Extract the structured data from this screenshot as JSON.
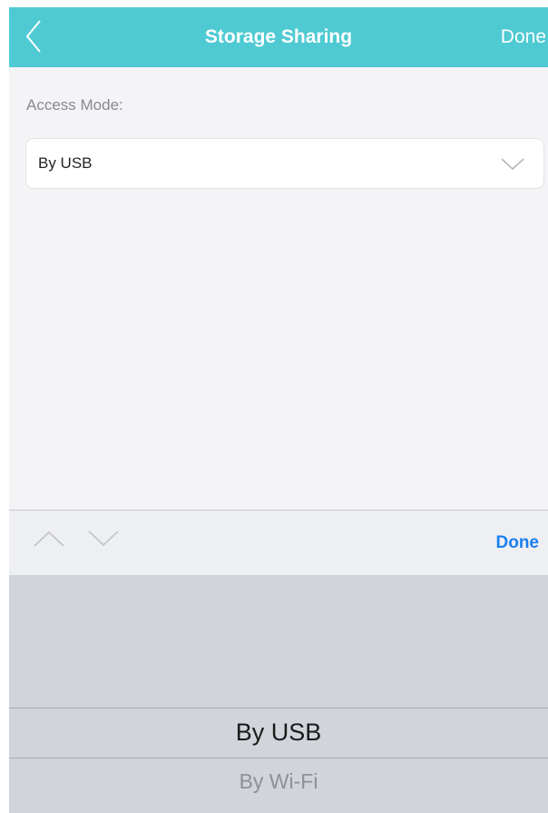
{
  "navbar": {
    "back_icon": "chevron-left-icon",
    "title": "Storage Sharing",
    "done_label": "Done",
    "color": "#4fcad3"
  },
  "form": {
    "access_mode_label": "Access Mode:",
    "access_mode_value": "By USB",
    "dropdown_icon": "chevron-down-icon"
  },
  "toolbar": {
    "prev_icon": "chevron-up-icon",
    "next_icon": "chevron-down-icon",
    "done_label": "Done",
    "accent_color": "#1b7ff0"
  },
  "picker": {
    "options": [
      "By USB",
      "By Wi-Fi"
    ],
    "selected": "By USB"
  }
}
